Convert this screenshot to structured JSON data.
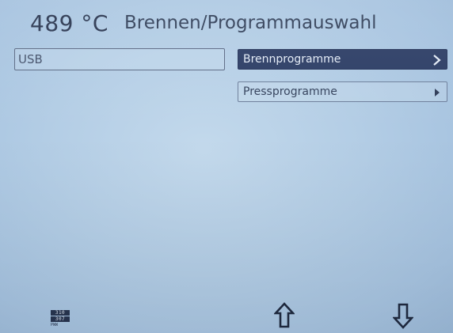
{
  "header": {
    "temperature": "489 °C",
    "title": "Brennen/Programmauswahl"
  },
  "source": {
    "label": "USB"
  },
  "menu": {
    "items": [
      {
        "label": "Brennprogramme",
        "selected": true,
        "icon": "chevron-right-icon"
      },
      {
        "label": "Pressprogramme",
        "selected": false,
        "icon": "triangle-right-icon"
      }
    ]
  },
  "softkeys": {
    "counter": {
      "line1": "310",
      "line2": "307",
      "line3": "PWW"
    },
    "up": {
      "icon": "arrow-up-icon"
    },
    "down": {
      "icon": "arrow-down-icon"
    }
  },
  "colors": {
    "background": "#b3cde5",
    "text": "#2c3a52",
    "selected_bg": "#2d3e66",
    "selected_text": "#e3ebf6"
  }
}
